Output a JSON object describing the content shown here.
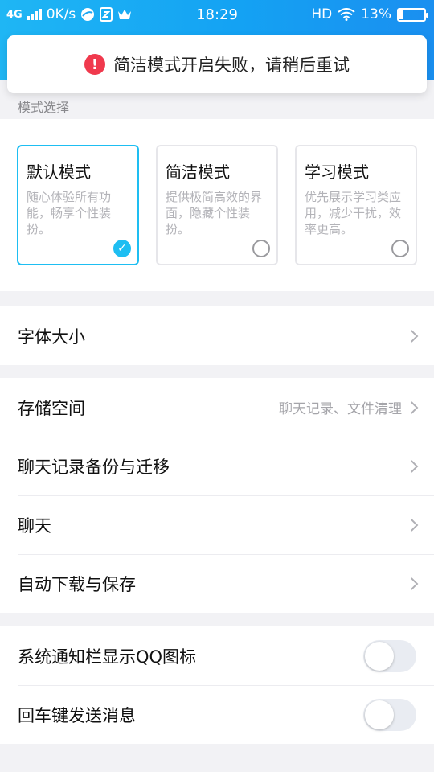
{
  "status_bar": {
    "network": "4G",
    "speed": "0K/s",
    "time": "18:29",
    "hd": "HD",
    "battery": "13%",
    "battery_level": 0.13
  },
  "toast": {
    "icon": "!",
    "message": "简洁模式开启失败，请稍后重试"
  },
  "modes": {
    "section_label": "模式选择",
    "cards": [
      {
        "title": "默认模式",
        "desc": "随心体验所有功能，畅享个性装扮。",
        "selected": true
      },
      {
        "title": "简洁模式",
        "desc": "提供极简高效的界面，隐藏个性装扮。",
        "selected": false
      },
      {
        "title": "学习模式",
        "desc": "优先展示学习类应用，减少干扰，效率更高。",
        "selected": false
      }
    ]
  },
  "settings": {
    "font_size": "字体大小",
    "storage": "存储空间",
    "storage_sub": "聊天记录、文件清理",
    "backup": "聊天记录备份与迁移",
    "chat": "聊天",
    "auto_download": "自动下载与保存",
    "notify_icon": "系统通知栏显示QQ图标",
    "enter_send": "回车键发送消息"
  },
  "toggles": {
    "notify_icon_on": false,
    "enter_send_on": false
  }
}
